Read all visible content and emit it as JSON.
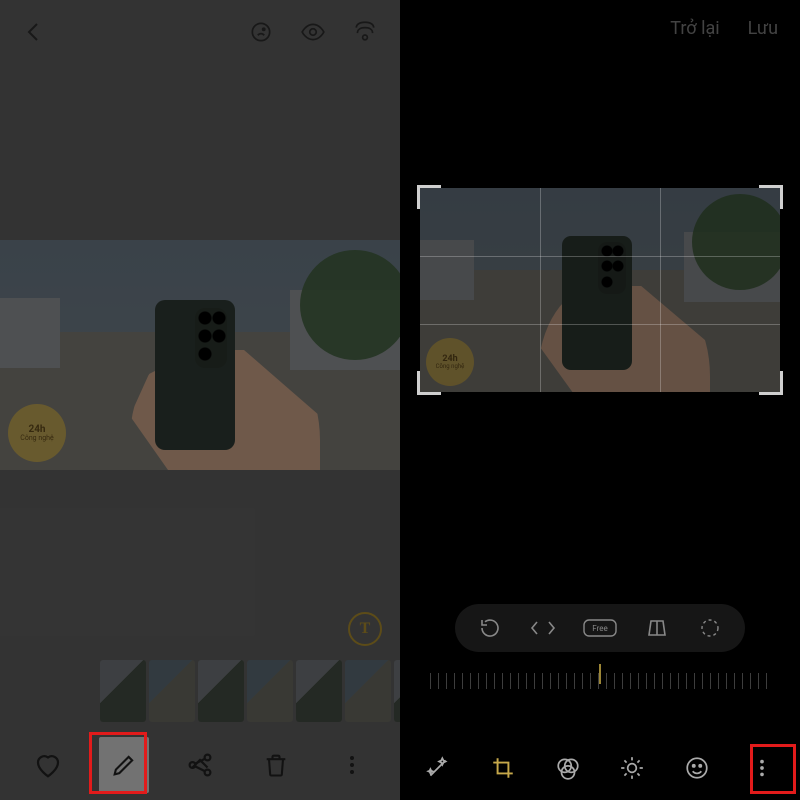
{
  "left": {
    "icons": {
      "back": "back-chevron",
      "bixby": "bixby-vision-icon",
      "eye": "visibility-icon",
      "cast": "smart-view-icon",
      "textbadge": "T"
    },
    "watermark": {
      "main": "24h",
      "sub": "Công nghệ"
    },
    "bottom": {
      "favorite": "heart-icon",
      "edit": "pencil-icon",
      "share": "share-icon",
      "delete": "trash-icon",
      "more": "more-icon"
    },
    "thumbnails_count": 7
  },
  "right": {
    "header": {
      "back": "Trở lại",
      "save": "Lưu"
    },
    "watermark": {
      "main": "24h",
      "sub": "Công nghệ"
    },
    "croptools": {
      "rotate": "rotate-icon",
      "flip": "flip-horizontal-icon",
      "ratio": "Free",
      "perspective": "perspective-icon",
      "lasso": "lasso-icon"
    },
    "bottom": {
      "auto": "auto-enhance-icon",
      "crop": "crop-transform-icon",
      "filter": "filters-icon",
      "adjust": "brightness-icon",
      "sticker": "emoji-icon",
      "more": "more-vertical-icon"
    }
  },
  "highlight": {
    "left_target": "edit-button",
    "right_target": "more-button"
  }
}
